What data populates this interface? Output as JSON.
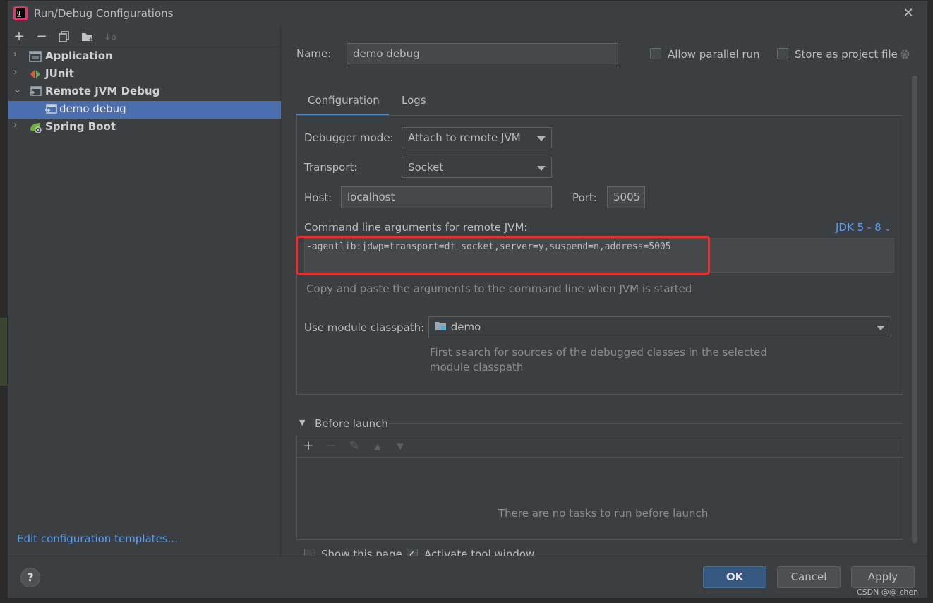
{
  "window": {
    "title": "Run/Debug Configurations",
    "close_glyph": "✕"
  },
  "toolbar": {
    "add": "+",
    "remove": "−",
    "copy": "⧉",
    "folder": "▇",
    "sort": "↓a"
  },
  "tree": {
    "items": [
      {
        "label": "Application",
        "arrow": "›",
        "icon": "application-icon"
      },
      {
        "label": "JUnit",
        "arrow": "›",
        "icon": "junit-icon"
      },
      {
        "label": "Remote JVM Debug",
        "arrow": "⌄",
        "icon": "remote-jvm-debug-icon"
      },
      {
        "label": "demo debug",
        "icon": "debug-config-icon",
        "selected": true
      },
      {
        "label": "Spring Boot",
        "arrow": "›",
        "icon": "spring-boot-icon"
      }
    ]
  },
  "edit_templates": "Edit configuration templates...",
  "name_field": {
    "label": "Name:",
    "value": "demo debug"
  },
  "allow_parallel": {
    "label": "Allow parallel run",
    "checked": false
  },
  "store_project": {
    "label": "Store as project file",
    "checked": false
  },
  "tabs": [
    {
      "label": "Configuration",
      "active": true
    },
    {
      "label": "Logs",
      "active": false
    }
  ],
  "config": {
    "debugger_mode": {
      "label": "Debugger mode:",
      "value": "Attach to remote JVM"
    },
    "transport": {
      "label": "Transport:",
      "value": "Socket"
    },
    "host": {
      "label": "Host:",
      "value": "localhost"
    },
    "port": {
      "label": "Port:",
      "value": "5005"
    },
    "cmd_label": "Command line arguments for remote JVM:",
    "jdk_link": "JDK 5 - 8",
    "cmd_value": "-agentlib:jdwp=transport=dt_socket,server=y,suspend=n,address=5005",
    "cmd_hint": "Copy and paste the arguments to the command line when JVM is started",
    "module": {
      "label": "Use module classpath:",
      "value": "demo"
    },
    "module_hint_1": "First search for sources of the debugged classes in the selected",
    "module_hint_2": "module classpath"
  },
  "before_launch": {
    "label": "Before launch",
    "empty_text": "There are no tasks to run before launch",
    "toolbar": {
      "add": "+",
      "remove": "−",
      "edit": "✎",
      "up": "▲",
      "down": "▼"
    }
  },
  "show_page": {
    "label": "Show this page",
    "checked": false
  },
  "activate_tool": {
    "label": "Activate tool window",
    "checked": true
  },
  "buttons": {
    "help": "?",
    "ok": "OK",
    "cancel": "Cancel",
    "apply": "Apply"
  },
  "watermark": "CSDN @@ chen",
  "colors": {
    "accent": "#365880",
    "selection": "#4b6eaf",
    "link": "#589df6",
    "highlight": "#e82e2e"
  }
}
